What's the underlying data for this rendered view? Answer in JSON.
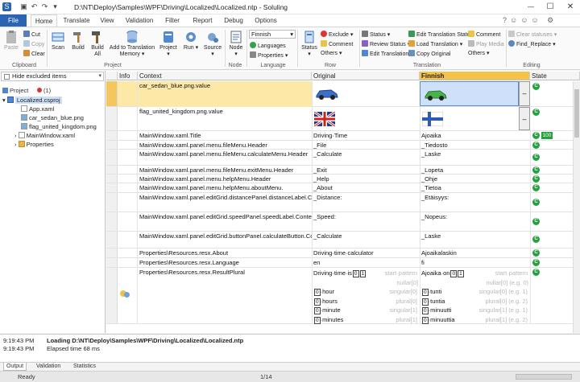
{
  "title_bar": {
    "title": "D:\\NT\\Deploy\\Samples\\WPF\\Driving\\Localized\\Localized.ntp  -  Soluling"
  },
  "tabs": [
    "File",
    "Home",
    "Translate",
    "View",
    "Validation",
    "Filter",
    "Report",
    "Debug",
    "Options"
  ],
  "ribbon": {
    "paste": "Paste",
    "cut": "Cut",
    "copy": "Copy",
    "clear": "Clear",
    "scan": "Scan",
    "build": "Build",
    "build_all": "Build All",
    "add_tm": "Add to Translation Memory",
    "project": "Project",
    "run": "Run",
    "source": "Source",
    "node": "Node",
    "lang_select": "Finnish",
    "languages": "Languages",
    "properties": "Properties",
    "status": "Status",
    "exclude": "Exclude",
    "status2": "Status",
    "others": "Others",
    "comment": "Comment",
    "review_status": "Review Status",
    "edit_translation": "Edit Translation",
    "edit_trans_state": "Edit Translation State",
    "load_translation": "Load Translation",
    "copy_original": "Copy Original",
    "comment2": "Comment",
    "play_media": "Play Media",
    "others2": "Others",
    "clear_statuses": "Clear statuses",
    "find_replace": "Find_Replace",
    "groups": {
      "clipboard": "Clipboard",
      "project": "Project",
      "node": "Node",
      "language": "Language",
      "row": "Row",
      "translation": "Translation",
      "editing": "Editing"
    }
  },
  "left_pane": {
    "filter": "Hide excluded items",
    "project_tab": "Project",
    "issues_tab": "(1)",
    "tree": [
      "Localized.csproj",
      "App.xaml",
      "car_sedan_blue.png",
      "flag_united_kingdom.png",
      "MainWindow.xaml",
      "Properties"
    ]
  },
  "grid": {
    "headers": {
      "info": "Info",
      "context": "Context",
      "original": "Original",
      "finnish": "Finnish",
      "state": "State"
    },
    "rows": [
      {
        "context": "car_sedan_blue.png.value",
        "original": "",
        "finnish": ""
      },
      {
        "context": "flag_united_kingdom.png.value",
        "original": "",
        "finnish": ""
      },
      {
        "context": "MainWindow.xaml.Title",
        "original": "Driving·Time",
        "finnish": "Ajoaika",
        "badge": "100"
      },
      {
        "context": "MainWindow.xaml.panel.menu.fileMenu.Header",
        "original": "_File",
        "finnish": "_Tiedosto"
      },
      {
        "context": "MainWindow.xaml.panel.menu.fileMenu.calculateMenu.Header",
        "original": "_Calculate",
        "finnish": "_Laske"
      },
      {
        "context": "MainWindow.xaml.panel.menu.fileMenu.exitMenu.Header",
        "original": "_Exit",
        "finnish": "_Lopeta"
      },
      {
        "context": "MainWindow.xaml.panel.menu.helpMenu.Header",
        "original": "_Help",
        "finnish": "_Ohje"
      },
      {
        "context": "MainWindow.xaml.panel.menu.helpMenu.aboutMenu.",
        "original": "_About",
        "finnish": "_Tietoa"
      },
      {
        "context": "MainWindow.xaml.panel.editGrid.distancePanel.distanceLabel.Content",
        "original": "_Distance:",
        "finnish": "_Etäisyys:"
      },
      {
        "context": "MainWindow.xaml.panel.editGrid.speedPanel.speedLabel.Content",
        "original": "_Speed:",
        "finnish": "_Nopeus:"
      },
      {
        "context": "MainWindow.xaml.panel.editGrid.buttonPanel.calculateButton.Content",
        "original": "_Calculate",
        "finnish": "_Laske"
      },
      {
        "context": "Properties\\Resources.resx.About",
        "original": "Driving·time·calculator",
        "finnish": "Ajoaikalaskin"
      },
      {
        "context": "Properties\\Resources.resx.Language",
        "original": "en",
        "finnish": "fi"
      },
      {
        "context": "Properties\\Resources.resx.ResultPlural",
        "original": "Driving·time·is",
        "finnish": "Ajoaika·on"
      }
    ],
    "plural": {
      "start": "start·pattern",
      "nullar": "nullar[0]",
      "singular0": "singular[0]",
      "plural0": "plural[0]",
      "singular1": "singular[1]",
      "plural1": "plural[1]",
      "orig": [
        "hour",
        "hours",
        "minute",
        "minutes"
      ],
      "fin": [
        "tunti",
        "tuntia",
        "minuutti",
        "minuuttia"
      ],
      "fin_tags": [
        "nullar[0] (e.g. 0)",
        "singular[0] (e.g. 1)",
        "plural[0] (e.g. 2)",
        "singular[1] (e.g. 1)",
        "plural[1] (e.g. 2)"
      ]
    }
  },
  "log": [
    {
      "time": "9:19:43 PM",
      "text": "Loading D:\\NT\\Deploy\\Samples\\WPF\\Driving\\Localized\\Localized.ntp"
    },
    {
      "time": "9:19:43 PM",
      "text": "Elapsed time 68 ms"
    }
  ],
  "bottom_tabs": [
    "Output",
    "Validation",
    "Statistics"
  ],
  "status_bar": {
    "left": "Ready",
    "mid": "1/14"
  },
  "colors": {
    "accent": "#2b64b3",
    "finnish_header": "#f5c24a",
    "state_green": "#27a140"
  }
}
